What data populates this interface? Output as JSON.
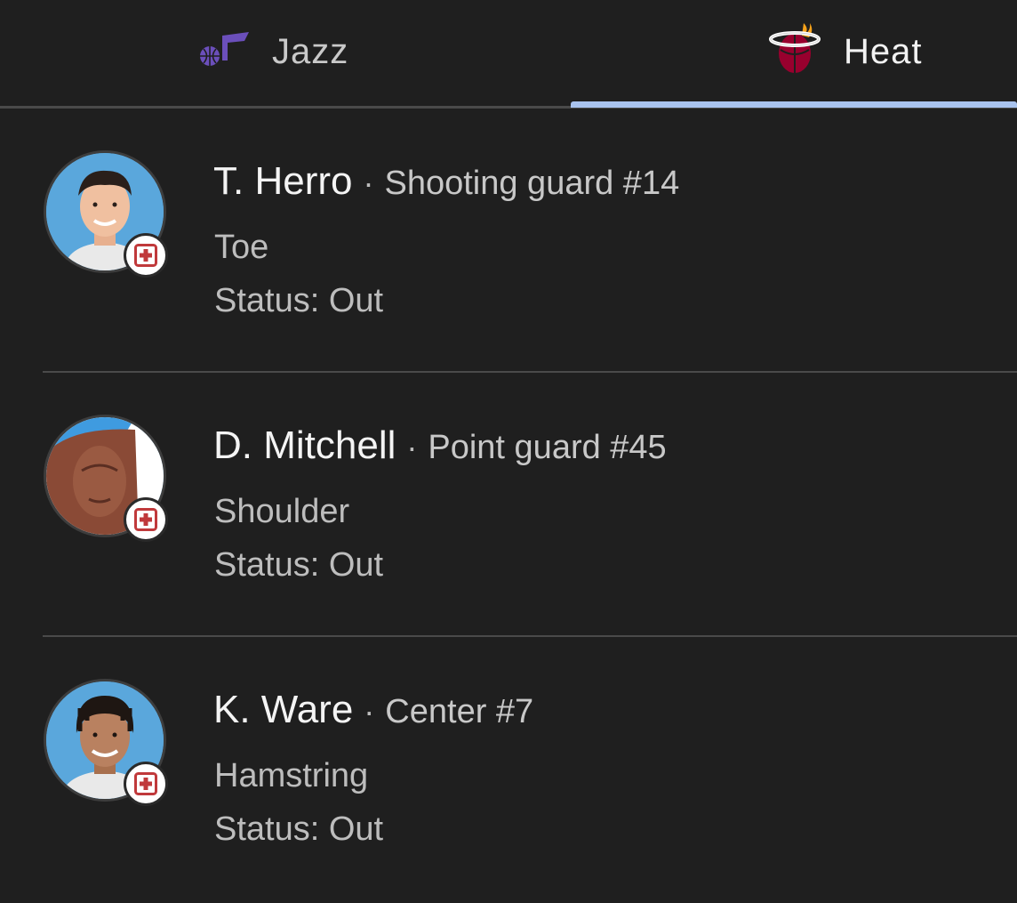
{
  "tabs": [
    {
      "label": "Jazz",
      "logo": "jazz-logo-icon",
      "selected": false
    },
    {
      "label": "Heat",
      "logo": "heat-logo-icon",
      "selected": true
    }
  ],
  "players": [
    {
      "name": "T. Herro",
      "separator": "·",
      "position": "Shooting guard #14",
      "injury": "Toe",
      "status": "Status: Out",
      "avatar": "player-headshot",
      "badge": "medical-cross-icon"
    },
    {
      "name": "D. Mitchell",
      "separator": "·",
      "position": "Point guard #45",
      "injury": "Shoulder",
      "status": "Status: Out",
      "avatar": "player-headshot",
      "badge": "medical-cross-icon"
    },
    {
      "name": "K. Ware",
      "separator": "·",
      "position": "Center #7",
      "injury": "Hamstring",
      "status": "Status: Out",
      "avatar": "player-headshot",
      "badge": "medical-cross-icon"
    }
  ],
  "colors": {
    "background": "#1f1f1f",
    "tab_indicator": "#a9c3ee",
    "divider": "#4a4a4a",
    "badge_red": "#c0393b"
  }
}
